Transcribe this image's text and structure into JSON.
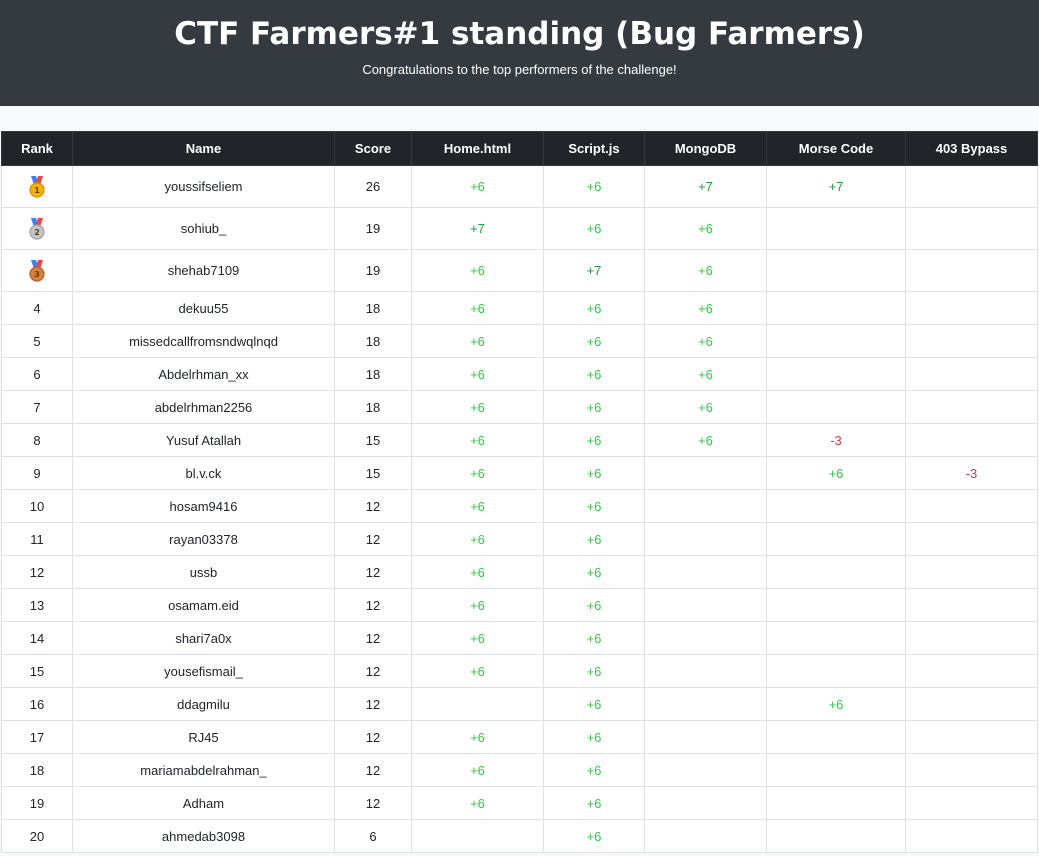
{
  "header": {
    "title": "CTF Farmers#1 standing (Bug Farmers)",
    "subtitle": "Congratulations to the top performers of the challenge!"
  },
  "table": {
    "columns": [
      "Rank",
      "Name",
      "Score",
      "Home.html",
      "Script.js",
      "MongoDB",
      "Morse Code",
      "403 Bypass"
    ],
    "medals": [
      "gold-medal-icon",
      "silver-medal-icon",
      "bronze-medal-icon"
    ],
    "colors": {
      "positive": "#28a745",
      "negative": "#dc3545",
      "header_bg": "#212529",
      "banner_bg": "#343a40"
    },
    "rows": [
      {
        "rank": "",
        "medal": "gold",
        "name": "youssifseliem",
        "score": "26",
        "home": "+6",
        "script": "+6",
        "mongo": "+7",
        "morse": "+7",
        "bypass": ""
      },
      {
        "rank": "",
        "medal": "silver",
        "name": "sohiub_",
        "score": "19",
        "home": "+7",
        "script": "+6",
        "mongo": "+6",
        "morse": "",
        "bypass": ""
      },
      {
        "rank": "",
        "medal": "bronze",
        "name": "shehab7109",
        "score": "19",
        "home": "+6",
        "script": "+7",
        "mongo": "+6",
        "morse": "",
        "bypass": ""
      },
      {
        "rank": "4",
        "name": "dekuu55",
        "score": "18",
        "home": "+6",
        "script": "+6",
        "mongo": "+6",
        "morse": "",
        "bypass": ""
      },
      {
        "rank": "5",
        "name": "missedcallfromsndwqlnqd",
        "score": "18",
        "home": "+6",
        "script": "+6",
        "mongo": "+6",
        "morse": "",
        "bypass": ""
      },
      {
        "rank": "6",
        "name": "Abdelrhman_xx",
        "score": "18",
        "home": "+6",
        "script": "+6",
        "mongo": "+6",
        "morse": "",
        "bypass": ""
      },
      {
        "rank": "7",
        "name": "abdelrhman2256",
        "score": "18",
        "home": "+6",
        "script": "+6",
        "mongo": "+6",
        "morse": "",
        "bypass": ""
      },
      {
        "rank": "8",
        "name": "Yusuf Atallah",
        "score": "15",
        "home": "+6",
        "script": "+6",
        "mongo": "+6",
        "morse": "-3",
        "bypass": ""
      },
      {
        "rank": "9",
        "name": "bl.v.ck",
        "score": "15",
        "home": "+6",
        "script": "+6",
        "mongo": "",
        "morse": "+6",
        "bypass": "-3"
      },
      {
        "rank": "10",
        "name": "hosam9416",
        "score": "12",
        "home": "+6",
        "script": "+6",
        "mongo": "",
        "morse": "",
        "bypass": ""
      },
      {
        "rank": "11",
        "name": "rayan03378",
        "score": "12",
        "home": "+6",
        "script": "+6",
        "mongo": "",
        "morse": "",
        "bypass": ""
      },
      {
        "rank": "12",
        "name": "ussb",
        "score": "12",
        "home": "+6",
        "script": "+6",
        "mongo": "",
        "morse": "",
        "bypass": ""
      },
      {
        "rank": "13",
        "name": "osamam.eid",
        "score": "12",
        "home": "+6",
        "script": "+6",
        "mongo": "",
        "morse": "",
        "bypass": ""
      },
      {
        "rank": "14",
        "name": "shari7a0x",
        "score": "12",
        "home": "+6",
        "script": "+6",
        "mongo": "",
        "morse": "",
        "bypass": ""
      },
      {
        "rank": "15",
        "name": "yousefismail_",
        "score": "12",
        "home": "+6",
        "script": "+6",
        "mongo": "",
        "morse": "",
        "bypass": ""
      },
      {
        "rank": "16",
        "name": "ddagmilu",
        "score": "12",
        "home": "",
        "script": "+6",
        "mongo": "",
        "morse": "+6",
        "bypass": ""
      },
      {
        "rank": "17",
        "name": "RJ45",
        "score": "12",
        "home": "+6",
        "script": "+6",
        "mongo": "",
        "morse": "",
        "bypass": ""
      },
      {
        "rank": "18",
        "name": "mariamabdelrahman_",
        "score": "12",
        "home": "+6",
        "script": "+6",
        "mongo": "",
        "morse": "",
        "bypass": ""
      },
      {
        "rank": "19",
        "name": "Adham",
        "score": "12",
        "home": "+6",
        "script": "+6",
        "mongo": "",
        "morse": "",
        "bypass": ""
      },
      {
        "rank": "20",
        "name": "ahmedab3098",
        "score": "6",
        "home": "",
        "script": "+6",
        "mongo": "",
        "morse": "",
        "bypass": ""
      }
    ]
  }
}
